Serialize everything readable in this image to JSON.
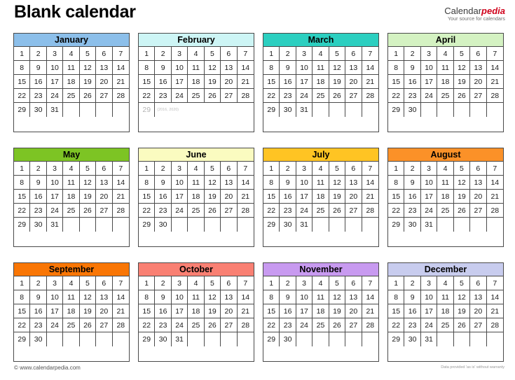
{
  "header": {
    "title": "Blank calendar",
    "brand_primary": "Calendar",
    "brand_accent": "pedia",
    "brand_tagline": "Your source for calendars"
  },
  "footer": {
    "copyright": "© www.calendarpedia.com",
    "disclaimer": "Data provided 'as is' without warranty"
  },
  "colors": {
    "january": "#8CBFEA",
    "february": "#CDF5F5",
    "march": "#2CCFC0",
    "april": "#D4F2C2",
    "may": "#7DC424",
    "june": "#FAFBC0",
    "july": "#FFC423",
    "august": "#FB9128",
    "september": "#F97605",
    "october": "#F98073",
    "november": "#C89AF0",
    "december": "#C8CCEE",
    "border": "#4a4a4a",
    "cell_bg": "#ffffff",
    "muted_text": "#b4b4b4"
  },
  "months": [
    {
      "name": "January",
      "color_key": "january",
      "weeks": [
        [
          "1",
          "2",
          "3",
          "4",
          "5",
          "6",
          "7"
        ],
        [
          "8",
          "9",
          "10",
          "11",
          "12",
          "13",
          "14"
        ],
        [
          "15",
          "16",
          "17",
          "18",
          "19",
          "20",
          "21"
        ],
        [
          "22",
          "23",
          "24",
          "25",
          "26",
          "27",
          "28"
        ],
        [
          "29",
          "30",
          "31",
          "",
          "",
          "",
          ""
        ]
      ]
    },
    {
      "name": "February",
      "color_key": "february",
      "leap_note": "(2016, 2020)",
      "weeks": [
        [
          "1",
          "2",
          "3",
          "4",
          "5",
          "6",
          "7"
        ],
        [
          "8",
          "9",
          "10",
          "11",
          "12",
          "13",
          "14"
        ],
        [
          "15",
          "16",
          "17",
          "18",
          "19",
          "20",
          "21"
        ],
        [
          "22",
          "23",
          "24",
          "25",
          "26",
          "27",
          "28"
        ],
        [
          "29",
          "",
          "",
          "",
          "",
          "",
          ""
        ]
      ]
    },
    {
      "name": "March",
      "color_key": "march",
      "weeks": [
        [
          "1",
          "2",
          "3",
          "4",
          "5",
          "6",
          "7"
        ],
        [
          "8",
          "9",
          "10",
          "11",
          "12",
          "13",
          "14"
        ],
        [
          "15",
          "16",
          "17",
          "18",
          "19",
          "20",
          "21"
        ],
        [
          "22",
          "23",
          "24",
          "25",
          "26",
          "27",
          "28"
        ],
        [
          "29",
          "30",
          "31",
          "",
          "",
          "",
          ""
        ]
      ]
    },
    {
      "name": "April",
      "color_key": "april",
      "weeks": [
        [
          "1",
          "2",
          "3",
          "4",
          "5",
          "6",
          "7"
        ],
        [
          "8",
          "9",
          "10",
          "11",
          "12",
          "13",
          "14"
        ],
        [
          "15",
          "16",
          "17",
          "18",
          "19",
          "20",
          "21"
        ],
        [
          "22",
          "23",
          "24",
          "25",
          "26",
          "27",
          "28"
        ],
        [
          "29",
          "30",
          "",
          "",
          "",
          "",
          ""
        ]
      ]
    },
    {
      "name": "May",
      "color_key": "may",
      "weeks": [
        [
          "1",
          "2",
          "3",
          "4",
          "5",
          "6",
          "7"
        ],
        [
          "8",
          "9",
          "10",
          "11",
          "12",
          "13",
          "14"
        ],
        [
          "15",
          "16",
          "17",
          "18",
          "19",
          "20",
          "21"
        ],
        [
          "22",
          "23",
          "24",
          "25",
          "26",
          "27",
          "28"
        ],
        [
          "29",
          "30",
          "31",
          "",
          "",
          "",
          ""
        ]
      ]
    },
    {
      "name": "June",
      "color_key": "june",
      "weeks": [
        [
          "1",
          "2",
          "3",
          "4",
          "5",
          "6",
          "7"
        ],
        [
          "8",
          "9",
          "10",
          "11",
          "12",
          "13",
          "14"
        ],
        [
          "15",
          "16",
          "17",
          "18",
          "19",
          "20",
          "21"
        ],
        [
          "22",
          "23",
          "24",
          "25",
          "26",
          "27",
          "28"
        ],
        [
          "29",
          "30",
          "",
          "",
          "",
          "",
          ""
        ]
      ]
    },
    {
      "name": "July",
      "color_key": "july",
      "weeks": [
        [
          "1",
          "2",
          "3",
          "4",
          "5",
          "6",
          "7"
        ],
        [
          "8",
          "9",
          "10",
          "11",
          "12",
          "13",
          "14"
        ],
        [
          "15",
          "16",
          "17",
          "18",
          "19",
          "20",
          "21"
        ],
        [
          "22",
          "23",
          "24",
          "25",
          "26",
          "27",
          "28"
        ],
        [
          "29",
          "30",
          "31",
          "",
          "",
          "",
          ""
        ]
      ]
    },
    {
      "name": "August",
      "color_key": "august",
      "weeks": [
        [
          "1",
          "2",
          "3",
          "4",
          "5",
          "6",
          "7"
        ],
        [
          "8",
          "9",
          "10",
          "11",
          "12",
          "13",
          "14"
        ],
        [
          "15",
          "16",
          "17",
          "18",
          "19",
          "20",
          "21"
        ],
        [
          "22",
          "23",
          "24",
          "25",
          "26",
          "27",
          "28"
        ],
        [
          "29",
          "30",
          "31",
          "",
          "",
          "",
          ""
        ]
      ]
    },
    {
      "name": "September",
      "color_key": "september",
      "weeks": [
        [
          "1",
          "2",
          "3",
          "4",
          "5",
          "6",
          "7"
        ],
        [
          "8",
          "9",
          "10",
          "11",
          "12",
          "13",
          "14"
        ],
        [
          "15",
          "16",
          "17",
          "18",
          "19",
          "20",
          "21"
        ],
        [
          "22",
          "23",
          "24",
          "25",
          "26",
          "27",
          "28"
        ],
        [
          "29",
          "30",
          "",
          "",
          "",
          "",
          ""
        ]
      ]
    },
    {
      "name": "October",
      "color_key": "october",
      "weeks": [
        [
          "1",
          "2",
          "3",
          "4",
          "5",
          "6",
          "7"
        ],
        [
          "8",
          "9",
          "10",
          "11",
          "12",
          "13",
          "14"
        ],
        [
          "15",
          "16",
          "17",
          "18",
          "19",
          "20",
          "21"
        ],
        [
          "22",
          "23",
          "24",
          "25",
          "26",
          "27",
          "28"
        ],
        [
          "29",
          "30",
          "31",
          "",
          "",
          "",
          ""
        ]
      ]
    },
    {
      "name": "November",
      "color_key": "november",
      "weeks": [
        [
          "1",
          "2",
          "3",
          "4",
          "5",
          "6",
          "7"
        ],
        [
          "8",
          "9",
          "10",
          "11",
          "12",
          "13",
          "14"
        ],
        [
          "15",
          "16",
          "17",
          "18",
          "19",
          "20",
          "21"
        ],
        [
          "22",
          "23",
          "24",
          "25",
          "26",
          "27",
          "28"
        ],
        [
          "29",
          "30",
          "",
          "",
          "",
          "",
          ""
        ]
      ]
    },
    {
      "name": "December",
      "color_key": "december",
      "weeks": [
        [
          "1",
          "2",
          "3",
          "4",
          "5",
          "6",
          "7"
        ],
        [
          "8",
          "9",
          "10",
          "11",
          "12",
          "13",
          "14"
        ],
        [
          "15",
          "16",
          "17",
          "18",
          "19",
          "20",
          "21"
        ],
        [
          "22",
          "23",
          "24",
          "25",
          "26",
          "27",
          "28"
        ],
        [
          "29",
          "30",
          "31",
          "",
          "",
          "",
          ""
        ]
      ]
    }
  ]
}
